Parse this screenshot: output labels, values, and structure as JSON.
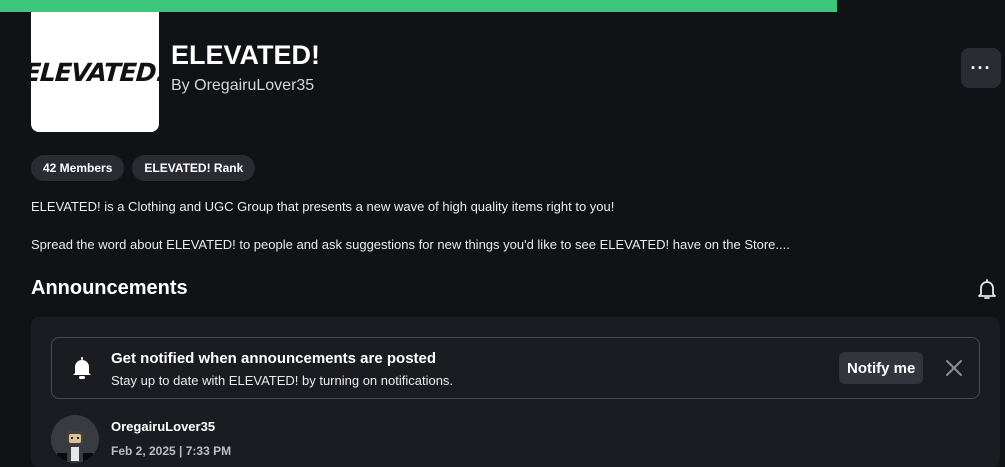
{
  "group": {
    "logo_text": "ELEVATED!",
    "name": "ELEVATED!",
    "owner_line": "By OregairuLover35"
  },
  "more_button": {
    "label": "···",
    "icon": "more-icon"
  },
  "chips": [
    {
      "label": "42 Members"
    },
    {
      "label": "ELEVATED! Rank"
    }
  ],
  "description": {
    "line1": "ELEVATED! is a Clothing and UGC Group that presents a new wave of high quality items right to you!",
    "line2": "Spread the word about ELEVATED! to people and ask suggestions for new things you'd like to see ELEVATED! have on the Store...."
  },
  "announcements": {
    "title": "Announcements",
    "header_icon": "bell-icon",
    "notify_card": {
      "title": "Get notified when announcements are posted",
      "subtitle": "Stay up to date with ELEVATED! by turning on notifications.",
      "button_label": "Notify me",
      "icon": "bell-icon",
      "close_icon": "close-icon"
    },
    "post": {
      "author": "OregairuLover35",
      "date": "Feb 2, 2025 | 7:33 PM"
    }
  },
  "colors": {
    "accent": "#3dc77c",
    "background": "#111216",
    "panel": "#1b1c21",
    "chip": "#2a2c33"
  }
}
